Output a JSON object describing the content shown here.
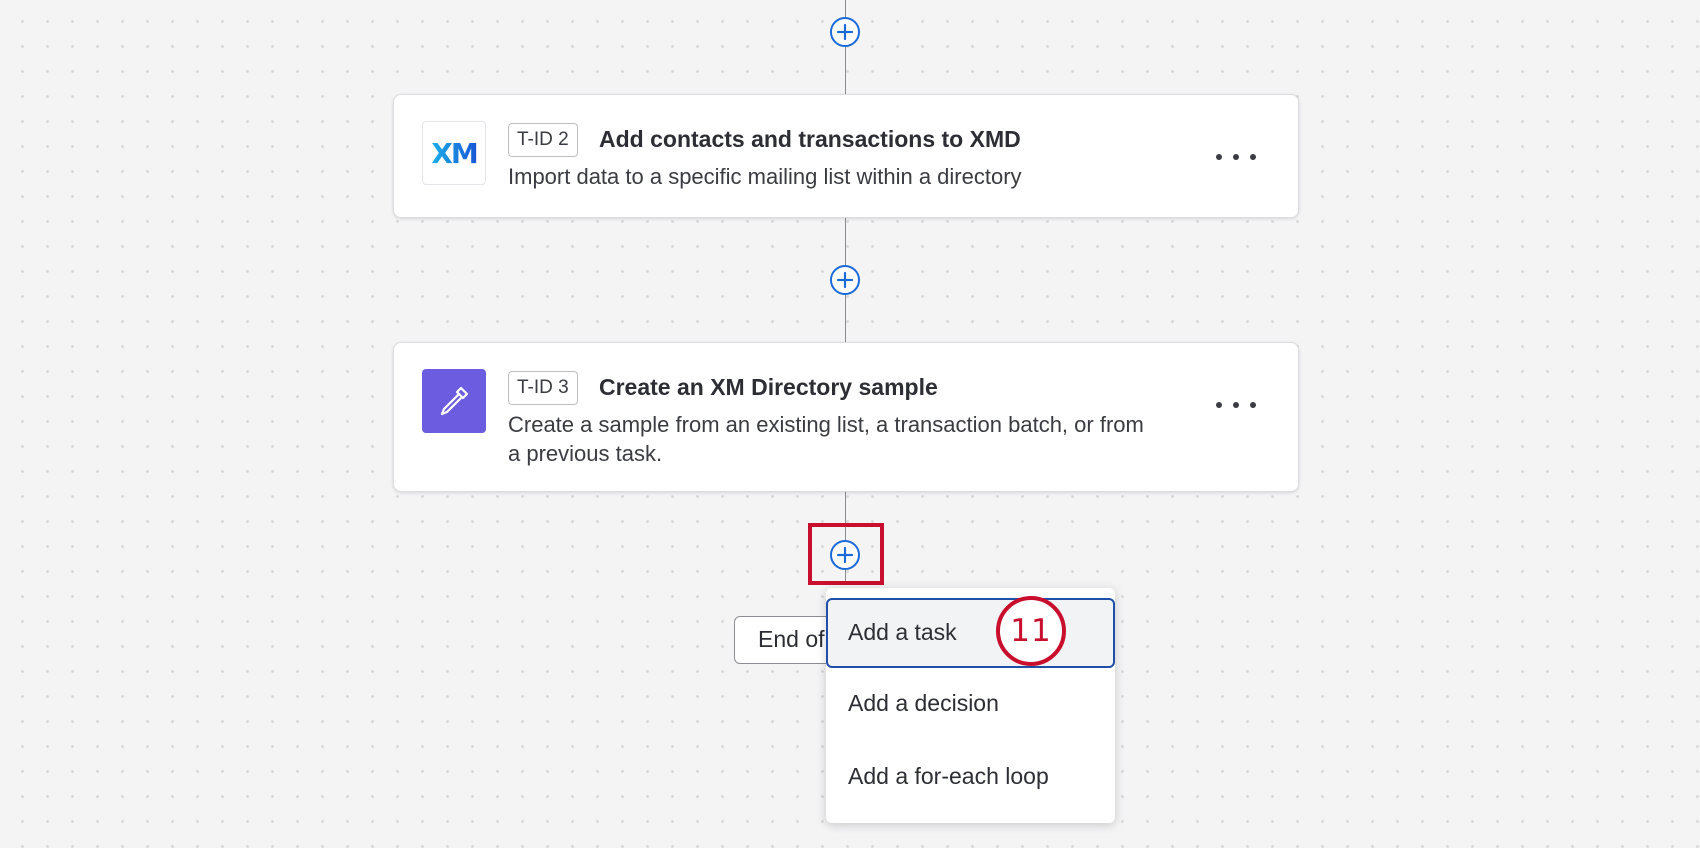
{
  "workflow": {
    "tasks": [
      {
        "id_label": "T-ID 2",
        "title": "Add contacts and transactions to XMD",
        "description": "Import data to a specific mailing list within a directory",
        "icon": "xm-logo-icon",
        "icon_text": "XM"
      },
      {
        "id_label": "T-ID 3",
        "title": "Create an XM Directory sample",
        "description": "Create a sample from an existing list, a transaction batch, or from a previous task.",
        "icon": "eyedropper-icon"
      }
    ],
    "end_label": "End of",
    "add_step_icon": "plus-circle-icon",
    "more_icon": "ellipsis-icon"
  },
  "add_menu": {
    "items": [
      "Add a task",
      "Add a decision",
      "Add a for-each loop"
    ]
  },
  "annotation": {
    "step_number": "11"
  },
  "colors": {
    "accent_blue": "#1a6ad8",
    "highlight_red": "#c8102e",
    "sample_icon_purple": "#6c5ce0"
  }
}
